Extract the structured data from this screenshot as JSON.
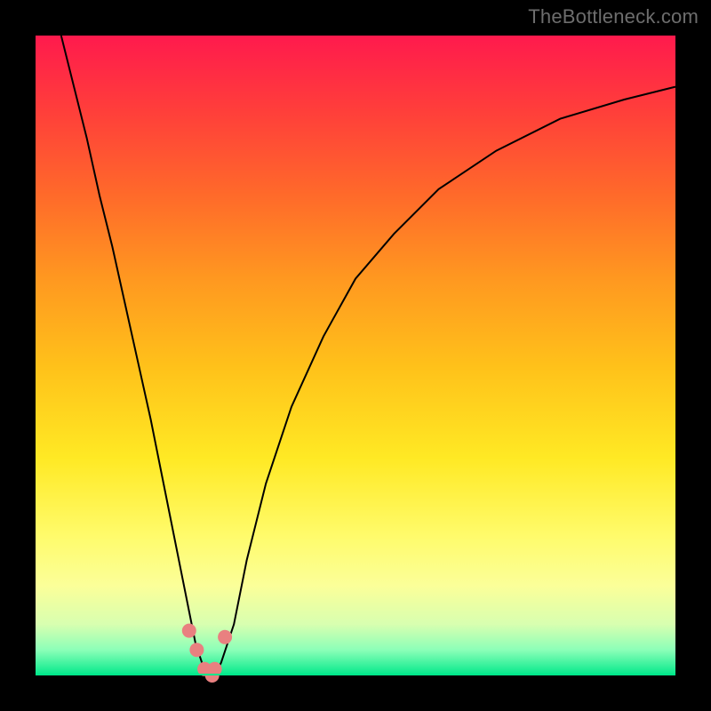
{
  "watermark": "TheBottleneck.com",
  "colors": {
    "frame": "#000000",
    "gradient_top": "#ff1a4d",
    "gradient_mid": "#ffe924",
    "gradient_bottom": "#00e88a",
    "curve": "#000000",
    "dots": "#e98080"
  },
  "chart_data": {
    "type": "line",
    "title": "",
    "xlabel": "",
    "ylabel": "",
    "xlim": [
      0,
      100
    ],
    "ylim": [
      0,
      100
    ],
    "x": [
      4,
      6,
      8,
      10,
      12,
      14,
      16,
      18,
      20,
      22,
      24,
      25,
      26,
      27,
      28,
      29,
      31,
      33,
      36,
      40,
      45,
      50,
      56,
      63,
      72,
      82,
      92,
      100
    ],
    "values": [
      100,
      92,
      84,
      75,
      67,
      58,
      49,
      40,
      30,
      20,
      10,
      5,
      2,
      0,
      0,
      2,
      8,
      18,
      30,
      42,
      53,
      62,
      69,
      76,
      82,
      87,
      90,
      92
    ],
    "annotations": {
      "dots_x": [
        24.0,
        25.2,
        26.4,
        27.6,
        28.0,
        29.6
      ],
      "dots_y": [
        7,
        4,
        1,
        0,
        1,
        6
      ]
    }
  }
}
